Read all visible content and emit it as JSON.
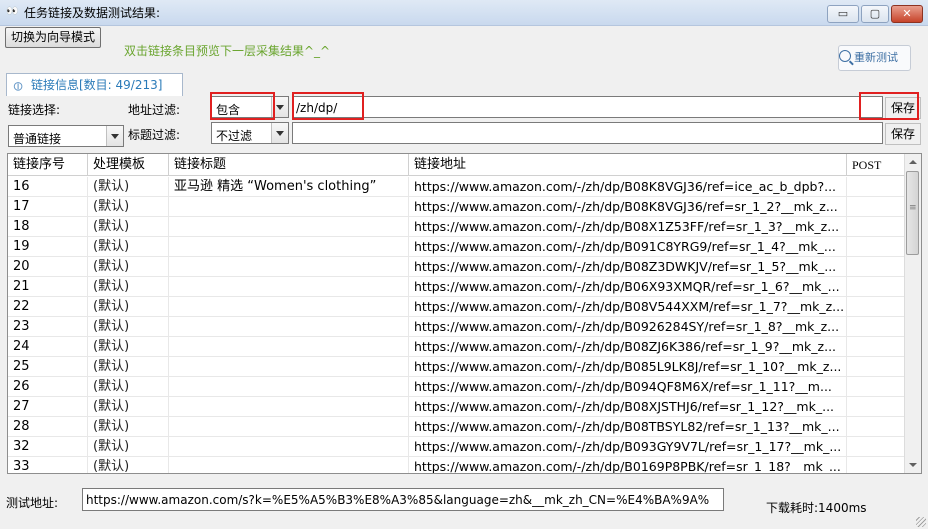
{
  "window": {
    "title": "任务链接及数据测试结果:",
    "title_icon": "👀",
    "minimize": "▭",
    "maximize": "▢",
    "close": "✕"
  },
  "toolbar": {
    "mode_button": "切换为向导模式",
    "hint": "双击链接条目预览下一层采集结果^_^",
    "retest_button": "重新测试"
  },
  "tab": {
    "label": "链接信息[数目: 49/213]"
  },
  "filters": {
    "link_select_label": "链接选择:",
    "link_select_value": "普通链接",
    "addr_filter_label": "地址过滤:",
    "addr_filter_mode": "包含",
    "addr_filter_value": "/zh/dp/",
    "title_filter_label": "标题过滤:",
    "title_filter_mode": "不过滤",
    "title_filter_value": "",
    "save_label": "保存"
  },
  "table": {
    "columns": [
      "链接序号",
      "处理模板",
      "链接标题",
      "链接地址",
      "POST"
    ],
    "rows": [
      [
        "16",
        "(默认)",
        "亚马逊 精选 “Women's clothing”",
        "https://www.amazon.com/-/zh/dp/B08K8VGJ36/ref=ice_ac_b_dpb?...",
        ""
      ],
      [
        "17",
        "(默认)",
        "",
        "https://www.amazon.com/-/zh/dp/B08K8VGJ36/ref=sr_1_2?__mk_z...",
        ""
      ],
      [
        "18",
        "(默认)",
        "",
        "https://www.amazon.com/-/zh/dp/B08X1Z53FF/ref=sr_1_3?__mk_z...",
        ""
      ],
      [
        "19",
        "(默认)",
        "",
        "https://www.amazon.com/-/zh/dp/B091C8YRG9/ref=sr_1_4?__mk_...",
        ""
      ],
      [
        "20",
        "(默认)",
        "",
        "https://www.amazon.com/-/zh/dp/B08Z3DWKJV/ref=sr_1_5?__mk_...",
        ""
      ],
      [
        "21",
        "(默认)",
        "",
        "https://www.amazon.com/-/zh/dp/B06X93XMQR/ref=sr_1_6?__mk_...",
        ""
      ],
      [
        "22",
        "(默认)",
        "",
        "https://www.amazon.com/-/zh/dp/B08V544XXM/ref=sr_1_7?__mk_z...",
        ""
      ],
      [
        "23",
        "(默认)",
        "",
        "https://www.amazon.com/-/zh/dp/B0926284SY/ref=sr_1_8?__mk_z...",
        ""
      ],
      [
        "24",
        "(默认)",
        "",
        "https://www.amazon.com/-/zh/dp/B08ZJ6K386/ref=sr_1_9?__mk_z...",
        ""
      ],
      [
        "25",
        "(默认)",
        "",
        "https://www.amazon.com/-/zh/dp/B085L9LK8J/ref=sr_1_10?__mk_z...",
        ""
      ],
      [
        "26",
        "(默认)",
        "",
        "https://www.amazon.com/-/zh/dp/B094QF8M6X/ref=sr_1_11?__m...",
        ""
      ],
      [
        "27",
        "(默认)",
        "",
        "https://www.amazon.com/-/zh/dp/B08XJSTHJ6/ref=sr_1_12?__mk_...",
        ""
      ],
      [
        "28",
        "(默认)",
        "",
        "https://www.amazon.com/-/zh/dp/B08TBSYL82/ref=sr_1_13?__mk_...",
        ""
      ],
      [
        "32",
        "(默认)",
        "",
        "https://www.amazon.com/-/zh/dp/B093GY9V7L/ref=sr_1_17?__mk_...",
        ""
      ],
      [
        "33",
        "(默认)",
        "",
        "https://www.amazon.com/-/zh/dp/B0169P8PBK/ref=sr_1_18?__mk_...",
        ""
      ]
    ]
  },
  "footer": {
    "test_label": "测试地址:",
    "test_url": "https://www.amazon.com/s?k=%E5%A5%B3%E8%A3%85&language=zh&__mk_zh_CN=%E4%BA%9A%",
    "download_time": "下载耗时:1400ms"
  },
  "colors": {
    "hint_green": "#6aa52f",
    "tab_blue": "#2a7ab8",
    "highlight_red": "#e02020"
  }
}
